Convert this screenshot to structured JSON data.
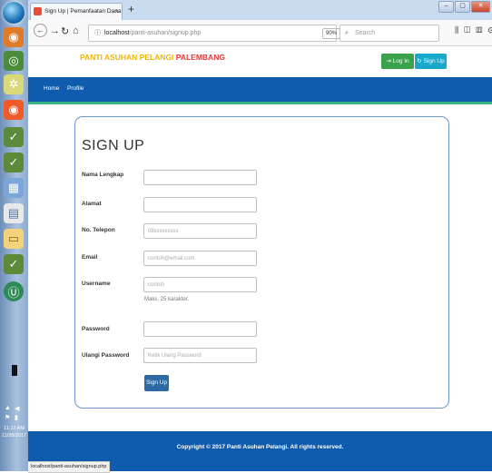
{
  "browser": {
    "tab_title": "Sign Up | Pemanfaatan Dana U",
    "tab_close": "×",
    "new_tab": "+",
    "url_host": "localhost",
    "url_path": "/panti-asuhan/signup.php",
    "zoom": "90%",
    "url_actions": "··· ⛉ ☆",
    "search_placeholder": "Search",
    "window_controls": [
      "–",
      "▢",
      "✕"
    ],
    "status_url": "localhost/panti-asuhan/signup.php"
  },
  "taskbar": {
    "clock_time": "11:12 AM",
    "clock_date": "11/28/2017",
    "icons": [
      "firefox-icon",
      "chrome-icon",
      "snow-icon",
      "firefox-icon",
      "app-icon",
      "app-icon",
      "calculator-icon",
      "document-icon",
      "folder-icon",
      "app-icon",
      "circle-app-icon"
    ]
  },
  "site": {
    "brand_a": "PANTI ASUHAN PELANGI",
    "brand_b": "PALEMBANG",
    "login_label": "Log In",
    "signup_label": "Sign Up",
    "menu": [
      "Home",
      "Profile"
    ],
    "footer": "Copyright © 2017 Panti Asuhan Pelangi. All rights reserved."
  },
  "form": {
    "title": "SIGN UP",
    "fields": [
      {
        "label": "Nama Lengkap",
        "placeholder": ""
      },
      {
        "label": "Alamat",
        "placeholder": ""
      },
      {
        "label": "No. Telepon",
        "placeholder": "08xxxxxxxxx"
      },
      {
        "label": "Email",
        "placeholder": "contoh@email.com"
      },
      {
        "label": "Username",
        "placeholder": "contoh"
      },
      {
        "label": "Password",
        "placeholder": ""
      },
      {
        "label": "Ulangi Password",
        "placeholder": "Ketik Ulang Password"
      }
    ],
    "username_help": "Maks. 25 karakter.",
    "submit_label": "Sign Up"
  },
  "colors": {
    "header_blue": "#0f5cae",
    "brand_yellow": "#f0b400",
    "brand_red": "#e53935",
    "login_green": "#3aa24a",
    "signup_cyan": "#18a8c9"
  }
}
